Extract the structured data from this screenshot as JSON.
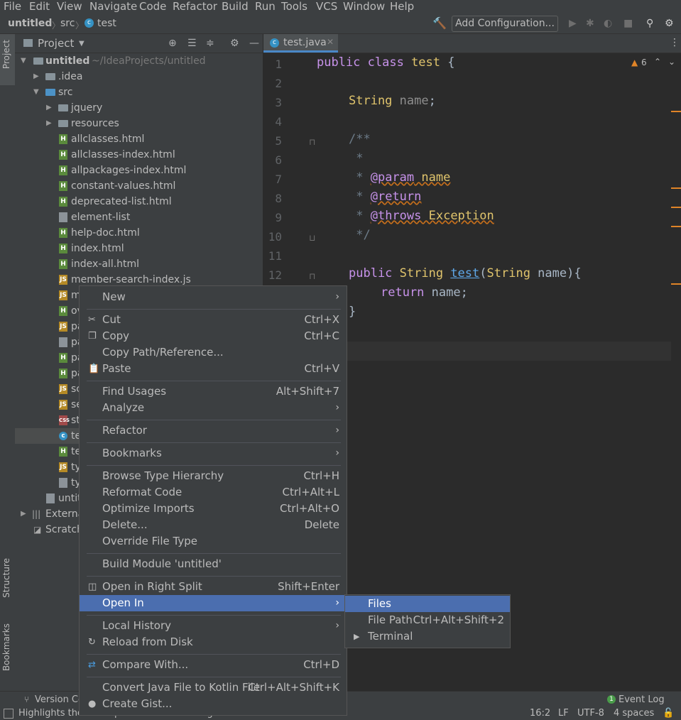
{
  "menubar": {
    "items": [
      "File",
      "Edit",
      "View",
      "Navigate",
      "Code",
      "Refactor",
      "Build",
      "Run",
      "Tools",
      "VCS",
      "Window",
      "Help"
    ]
  },
  "navbar": {
    "project": "untitled",
    "folder": "src",
    "file": "test",
    "add_configuration": "Add Configuration..."
  },
  "left_stripe": {
    "project": "Project",
    "structure": "Structure",
    "bookmarks": "Bookmarks"
  },
  "project_panel": {
    "title": "Project",
    "root_name": "untitled",
    "root_path": "~/IdeaProjects/untitled",
    "items": [
      {
        "name": ".idea"
      },
      {
        "name": "src"
      },
      {
        "name": "jquery"
      },
      {
        "name": "resources"
      },
      {
        "name": "allclasses.html"
      },
      {
        "name": "allclasses-index.html"
      },
      {
        "name": "allpackages-index.html"
      },
      {
        "name": "constant-values.html"
      },
      {
        "name": "deprecated-list.html"
      },
      {
        "name": "element-list"
      },
      {
        "name": "help-doc.html"
      },
      {
        "name": "index.html"
      },
      {
        "name": "index-all.html"
      },
      {
        "name": "member-search-index.js"
      },
      {
        "name": "m"
      },
      {
        "name": "ov"
      },
      {
        "name": "pa"
      },
      {
        "name": "pa"
      },
      {
        "name": "pa"
      },
      {
        "name": "pa"
      },
      {
        "name": "sc"
      },
      {
        "name": "se"
      },
      {
        "name": "st"
      },
      {
        "name": "te"
      },
      {
        "name": "te"
      },
      {
        "name": "ty"
      },
      {
        "name": "ty"
      },
      {
        "name": "untit"
      },
      {
        "name": "Externa"
      },
      {
        "name": "Scratch"
      }
    ]
  },
  "editor": {
    "tab_label": "test.java",
    "warning_count": "6",
    "line_numbers": [
      "1",
      "2",
      "3",
      "4",
      "5",
      "6",
      "7",
      "8",
      "9",
      "10",
      "11",
      "12"
    ]
  },
  "code": {
    "l1_kw": "public class ",
    "l1_cls": "test",
    "l1_brace": " {",
    "l3_type": "String ",
    "l3_field": "name",
    "l3_semi": ";",
    "l5": "/**",
    "l6": " *",
    "l7_star": " * ",
    "l7_tag": "@param",
    "l7_val": " name",
    "l8_star": " * ",
    "l8_tag": "@return",
    "l9_star": " * ",
    "l9_tag": "@throws",
    "l9_val": " Exception",
    "l10": " */",
    "l12_kw": "public ",
    "l12_type": "String ",
    "l12_fn": "test",
    "l12_p1": "(",
    "l12_ptype": "String ",
    "l12_pname": "name",
    "l12_p2": "){",
    "l13_kw": "return ",
    "l13_field": "name",
    "l13_semi": ";",
    "l14": "}"
  },
  "context_menu": {
    "new": "New",
    "cut": "Cut",
    "cut_sc": "Ctrl+X",
    "copy": "Copy",
    "copy_sc": "Ctrl+C",
    "copy_path": "Copy Path/Reference...",
    "paste": "Paste",
    "paste_sc": "Ctrl+V",
    "find_usages": "Find Usages",
    "find_usages_sc": "Alt+Shift+7",
    "analyze": "Analyze",
    "refactor": "Refactor",
    "bookmarks": "Bookmarks",
    "browse_type": "Browse Type Hierarchy",
    "browse_type_sc": "Ctrl+H",
    "reformat": "Reformat Code",
    "reformat_sc": "Ctrl+Alt+L",
    "optimize": "Optimize Imports",
    "optimize_sc": "Ctrl+Alt+O",
    "delete": "Delete...",
    "delete_sc": "Delete",
    "override": "Override File Type",
    "build_module": "Build Module 'untitled'",
    "open_right": "Open in Right Split",
    "open_right_sc": "Shift+Enter",
    "open_in": "Open In",
    "local_history": "Local History",
    "reload": "Reload from Disk",
    "compare": "Compare With...",
    "compare_sc": "Ctrl+D",
    "convert": "Convert Java File to Kotlin File",
    "convert_sc": "Ctrl+Alt+Shift+K",
    "gist": "Create Gist..."
  },
  "submenu": {
    "files": "Files",
    "file_path": "File Path",
    "file_path_sc": "Ctrl+Alt+Shift+2",
    "terminal": "Terminal"
  },
  "bottom": {
    "version_control": "Version Co",
    "event_log": "Event Log",
    "event_badge": "1"
  },
  "status": {
    "message": "Highlights the file in platform's file manager",
    "position": "16:2",
    "line_sep": "LF",
    "encoding": "UTF-8",
    "indent": "4 spaces"
  }
}
